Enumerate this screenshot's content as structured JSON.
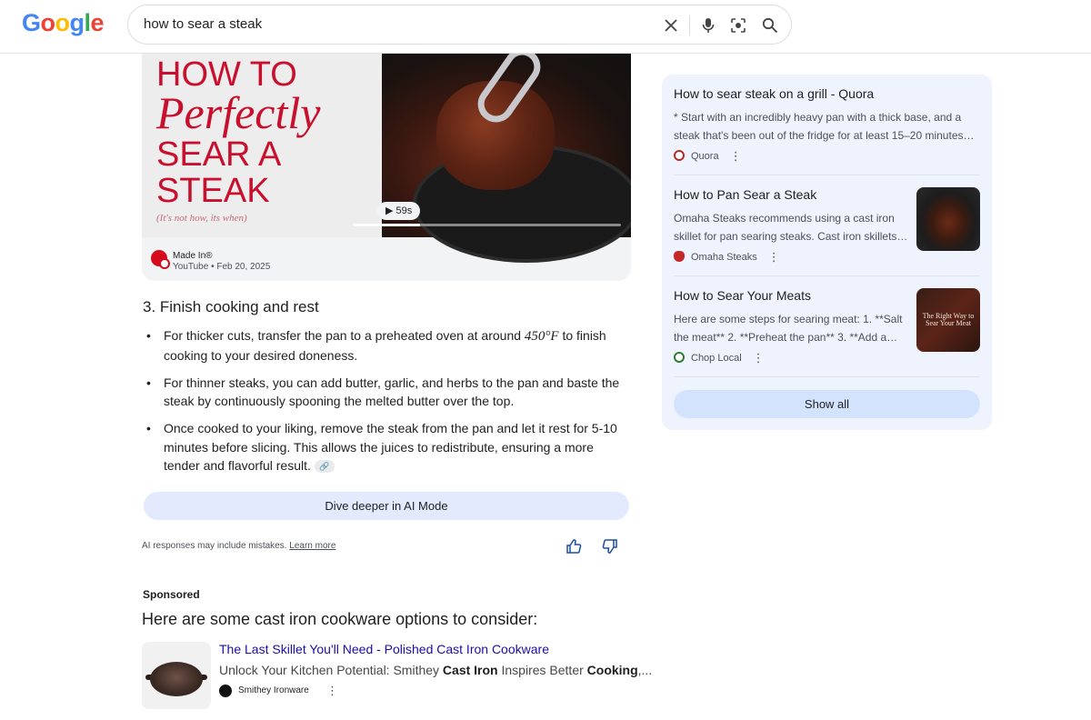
{
  "header": {
    "logo": "Google",
    "search_query": "how to sear a steak"
  },
  "video": {
    "title_lines": [
      "HOW TO",
      "Perfectly",
      "SEAR A",
      "STEAK",
      "(It's not how, its when)"
    ],
    "duration": "▶ 59s",
    "progress": 0.25,
    "channel": "Made In®",
    "meta": "YouTube • Feb 20, 2025"
  },
  "ai": {
    "section_title": "3. Finish cooking and rest",
    "bullet1_pre": "For thicker cuts, transfer the pan to a preheated oven at around ",
    "bullet1_math": "450°F",
    "bullet1_post": " to finish cooking to your desired doneness.",
    "bullet2": "For thinner steaks, you can add butter, garlic, and herbs to the pan and baste the steak by continuously spooning the melted butter over the top.",
    "bullet3": "Once cooked to your liking, remove the steak from the pan and let it rest for 5-10 minutes before slicing. This allows the juices to redistribute, ensuring a more tender and flavorful result.",
    "dive_deeper": "Dive deeper in AI Mode",
    "disclaimer": "AI responses may include mistakes.",
    "learn_more": "Learn more"
  },
  "sponsored": {
    "label": "Sponsored",
    "heading": "Here are some cast iron cookware options to consider:",
    "ad_title": "The Last Skillet You'll Need - Polished Cast Iron Cookware",
    "ad_desc_1": "Unlock Your Kitchen Potential: Smithey ",
    "ad_desc_bold_1": "Cast Iron",
    "ad_desc_2": " Inspires Better ",
    "ad_desc_bold_2": "Cooking",
    "ad_desc_3": ",...",
    "ad_source": "Smithey Ironware"
  },
  "side": {
    "items": [
      {
        "title": "How to sear steak on a grill - Quora",
        "snippet": "* Start with an incredibly heavy pan with a thick base, and a steak that's been out of the fridge for at least 15–20 minutes…",
        "source": "Quora",
        "color": "#b92b27"
      },
      {
        "title": "How to Pan Sear a Steak",
        "snippet": "Omaha Steaks recommends using a cast iron skillet for pan searing steaks. Cast iron skillets…",
        "source": "Omaha Steaks",
        "color": "#c62828"
      },
      {
        "title": "How to Sear Your Meats",
        "snippet": "Here are some steps for searing meat: 1. **Salt the meat** 2. **Preheat the pan** 3. **Add a…",
        "source": "Chop Local",
        "thumb_text": "The Right Way to Sear Your Meat",
        "color": "#2e7d32"
      }
    ],
    "show_all": "Show all"
  }
}
